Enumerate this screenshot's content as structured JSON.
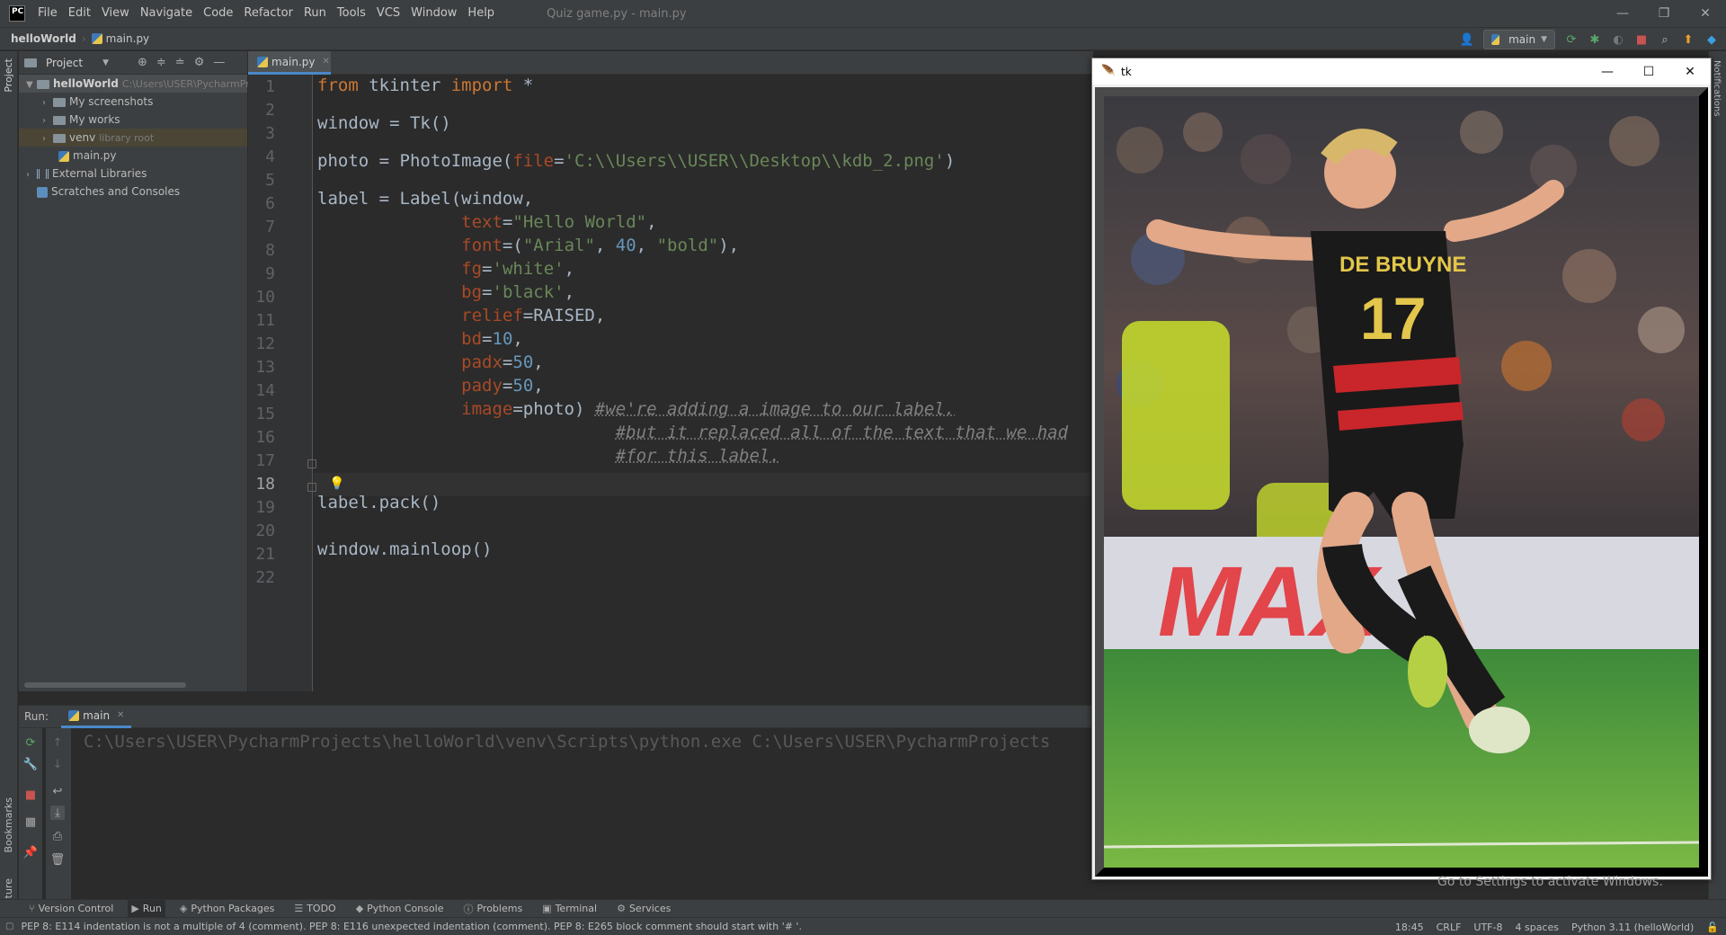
{
  "app": {
    "logo": "PC",
    "menu": [
      "File",
      "Edit",
      "View",
      "Navigate",
      "Code",
      "Refactor",
      "Run",
      "Tools",
      "VCS",
      "Window",
      "Help"
    ],
    "window_title": "Quiz game.py - main.py"
  },
  "navbar": {
    "project": "helloWorld",
    "file": "main.py",
    "branch": "main"
  },
  "project_panel": {
    "title": "Project",
    "tree": [
      {
        "label": "helloWorld",
        "extra": "C:\\Users\\USER\\PycharmPro",
        "type": "root"
      },
      {
        "label": "My screenshots",
        "type": "folder"
      },
      {
        "label": "My works",
        "type": "folder"
      },
      {
        "label": "venv",
        "extra": "library root",
        "type": "folder"
      },
      {
        "label": "main.py",
        "type": "file"
      },
      {
        "label": "External Libraries",
        "type": "lib"
      },
      {
        "label": "Scratches and Consoles",
        "type": "scratch"
      }
    ]
  },
  "editor": {
    "tab": "main.py",
    "current_line": 18,
    "line_numbers": [
      "1",
      "2",
      "3",
      "4",
      "5",
      "6",
      "7",
      "8",
      "9",
      "10",
      "11",
      "12",
      "13",
      "14",
      "15",
      "16",
      "17",
      "18",
      "19",
      "20",
      "21",
      "22"
    ]
  },
  "run": {
    "label": "Run:",
    "tab": "main",
    "console_line": "C:\\Users\\USER\\PycharmProjects\\helloWorld\\venv\\Scripts\\python.exe C:\\Users\\USER\\PycharmProjects"
  },
  "bottom_tabs": [
    "Version Control",
    "Run",
    "Python Packages",
    "TODO",
    "Python Console",
    "Problems",
    "Terminal",
    "Services"
  ],
  "stripes": {
    "project": "Project",
    "bookmarks": "Bookmarks",
    "structure": "Structure",
    "notifications": "Notifications"
  },
  "status": {
    "message": "PEP 8: E114 indentation is not a multiple of 4 (comment). PEP 8: E116 unexpected indentation (comment). PEP 8: E265 block comment should start with '# '.",
    "position": "18:45",
    "line_sep": "CRLF",
    "encoding": "UTF-8",
    "indent": "4 spaces",
    "interpreter": "Python 3.11 (helloWorld)"
  },
  "tk_window": {
    "title": "tk"
  },
  "photo": {
    "jersey_name": "DE BRUYNE",
    "jersey_number": "17",
    "board_text": "MAX"
  },
  "watermark": "Go to Settings to activate Windows.",
  "colors": {
    "keyword": "#cc7832",
    "string": "#6a8759",
    "number": "#6897bb",
    "param": "#aa4926",
    "accent": "#4a88c7"
  }
}
